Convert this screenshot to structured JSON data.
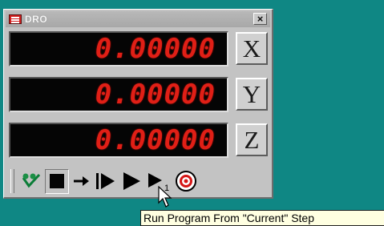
{
  "window": {
    "title": "DRO",
    "close_label": "×"
  },
  "readouts": [
    {
      "axis": "X",
      "value": "0.00000"
    },
    {
      "axis": "Y",
      "value": "0.00000"
    },
    {
      "axis": "Z",
      "value": "0.00000"
    }
  ],
  "toolbar": {
    "subscript_step": "1"
  },
  "tooltip": {
    "text": "Run Program From \"Current\" Step"
  },
  "colors": {
    "desktop": "#0f8784",
    "readout_text": "#e01f16",
    "readout_bg": "#050505",
    "tooltip_bg": "#ffffe1"
  }
}
